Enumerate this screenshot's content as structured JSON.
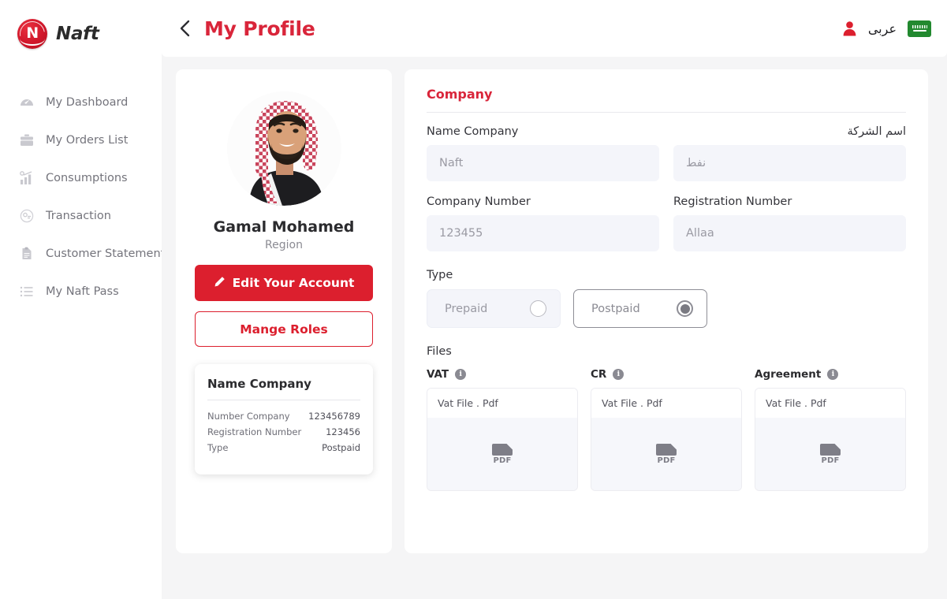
{
  "brand": {
    "name": "Naft",
    "logo_letter": "N",
    "accent": "#dc1f2e"
  },
  "sidebar": {
    "items": [
      {
        "label": "My Dashboard",
        "icon": "dashboard-icon"
      },
      {
        "label": "My Orders List",
        "icon": "briefcase-icon"
      },
      {
        "label": "Consumptions",
        "icon": "bar-chart-icon"
      },
      {
        "label": "Transaction",
        "icon": "transaction-icon"
      },
      {
        "label": "Customer Statement",
        "icon": "document-icon"
      },
      {
        "label": "My Naft Pass",
        "icon": "list-icon"
      }
    ]
  },
  "topbar": {
    "title": "My Profile",
    "back_icon": "chevron-left-icon",
    "user_icon": "user-icon",
    "language_label": "عربى",
    "flag": "saudi-arabia-flag"
  },
  "profile": {
    "avatar_alt": "profile-photo",
    "name": "Gamal Mohamed",
    "region": "Region",
    "edit_button": "Edit Your Account",
    "edit_icon": "pencil-icon",
    "roles_button": "Mange Roles",
    "summary": {
      "title": "Name Company",
      "rows": [
        {
          "key": "Number Company",
          "value": "123456789"
        },
        {
          "key": "Registration Number",
          "value": "123456"
        },
        {
          "key": "Type",
          "value": "Postpaid"
        }
      ]
    }
  },
  "company": {
    "section_title": "Company",
    "fields": [
      {
        "label": "Name Company",
        "value": "Naft",
        "rtl": false
      },
      {
        "label": "اسم الشركة",
        "value": "نفط",
        "rtl": true
      },
      {
        "label": "Company Number",
        "value": "123455",
        "rtl": false
      },
      {
        "label": "Registration Number",
        "value": "Allaa",
        "rtl": false
      }
    ],
    "type": {
      "label": "Type",
      "options": [
        {
          "label": "Prepaid",
          "selected": false
        },
        {
          "label": "Postpaid",
          "selected": true
        }
      ]
    },
    "files": {
      "label": "Files",
      "items": [
        {
          "title": "VAT",
          "info_icon": "info-icon",
          "file_name": "Vat File . Pdf",
          "preview": "PDF"
        },
        {
          "title": "CR",
          "info_icon": "info-icon",
          "file_name": "Vat File . Pdf",
          "preview": "PDF"
        },
        {
          "title": "Agreement",
          "info_icon": "info-icon",
          "file_name": "Vat File . Pdf",
          "preview": "PDF"
        }
      ]
    }
  }
}
